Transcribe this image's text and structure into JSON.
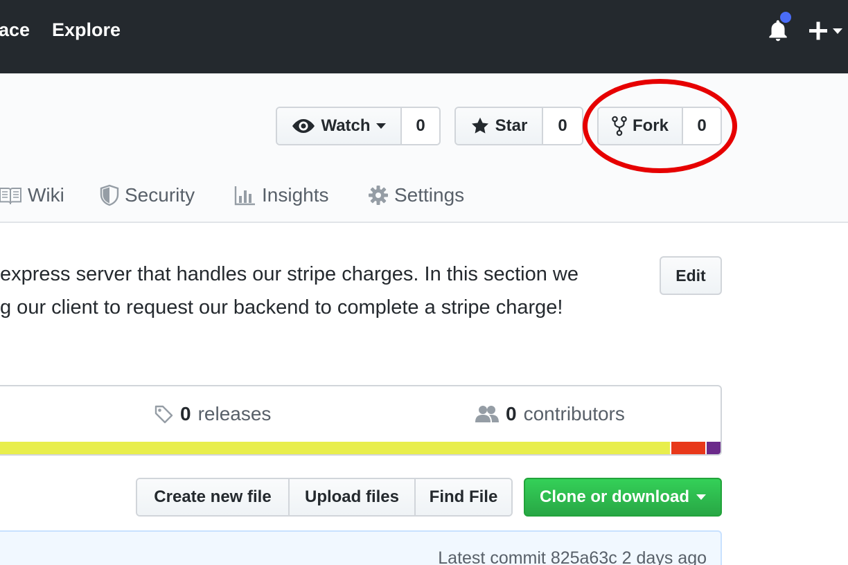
{
  "nav": {
    "partial_link": "ace",
    "explore": "Explore"
  },
  "actions": {
    "watch": {
      "label": "Watch",
      "count": "0"
    },
    "star": {
      "label": "Star",
      "count": "0"
    },
    "fork": {
      "label": "Fork",
      "count": "0"
    }
  },
  "tabs": [
    {
      "label": "Wiki"
    },
    {
      "label": "Security"
    },
    {
      "label": "Insights"
    },
    {
      "label": "Settings"
    }
  ],
  "description": {
    "line1": "express server that handles our stripe charges. In this section we",
    "line2": "g our client to request our backend to complete a stripe charge!",
    "edit": "Edit"
  },
  "stats": {
    "releases_count": "0",
    "releases_label": "releases",
    "contributors_count": "0",
    "contributors_label": "contributors"
  },
  "language_bar": [
    {
      "color": "#e8ee4c",
      "fraction": 0.93
    },
    {
      "color": "#e8381a",
      "fraction": 0.049
    },
    {
      "color": "#6b2a8a",
      "fraction": 0.021
    }
  ],
  "file_actions": {
    "create": "Create new file",
    "upload": "Upload files",
    "find": "Find File",
    "clone": "Clone or download"
  },
  "commit": {
    "text": "Latest commit 825a63c 2 days ago"
  },
  "colors": {
    "header": "#24292e",
    "notification": "#4a6cf7",
    "highlight": "#e60000",
    "primary_button": "#28a745"
  }
}
